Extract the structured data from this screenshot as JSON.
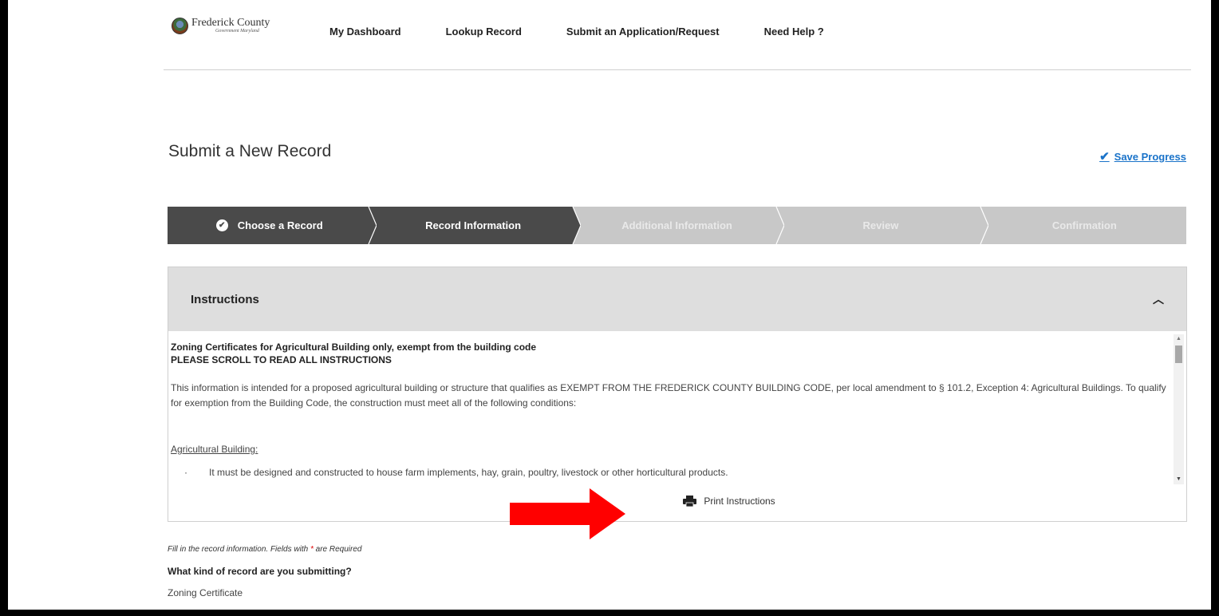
{
  "logo": {
    "main": "Frederick County",
    "sub": "Government Maryland"
  },
  "nav": [
    {
      "label": "My Dashboard"
    },
    {
      "label": "Lookup Record"
    },
    {
      "label": "Submit an Application/Request"
    },
    {
      "label": "Need Help ?"
    }
  ],
  "page": {
    "title": "Submit a New Record",
    "save_progress": "Save Progress"
  },
  "steps": [
    {
      "label": "Choose a Record",
      "state": "done"
    },
    {
      "label": "Record Information",
      "state": "active"
    },
    {
      "label": "Additional Information",
      "state": "todo"
    },
    {
      "label": "Review",
      "state": "todo"
    },
    {
      "label": "Confirmation",
      "state": "todo"
    }
  ],
  "instructions": {
    "title": "Instructions",
    "heading1": "Zoning Certificates for Agricultural Building only, exempt from the building code",
    "heading2": "PLEASE SCROLL TO READ ALL INSTRUCTIONS",
    "paragraph": "This information is intended for a proposed agricultural building or structure that qualifies as EXEMPT FROM THE FREDERICK COUNTY BUILDING CODE, per local amendment to § 101.2, Exception 4: Agricultural Buildings. To qualify for exemption from the Building Code, the construction must meet all of the following conditions:",
    "subheading": "Agricultural Building:",
    "bullet1": "It must be designed and constructed to house farm implements, hay, grain, poultry, livestock or other horticultural products.",
    "print_label": "Print Instructions"
  },
  "form": {
    "note_prefix": "Fill in the record information. Fields with ",
    "note_star": "*",
    "note_suffix": " are Required",
    "question": "What kind of record are you submitting?",
    "answer": "Zoning Certificate"
  },
  "colors": {
    "step_dark": "#4a4a4a",
    "step_light": "#c8c8c8",
    "link": "#1a73c9",
    "annotation": "#ff0000"
  }
}
